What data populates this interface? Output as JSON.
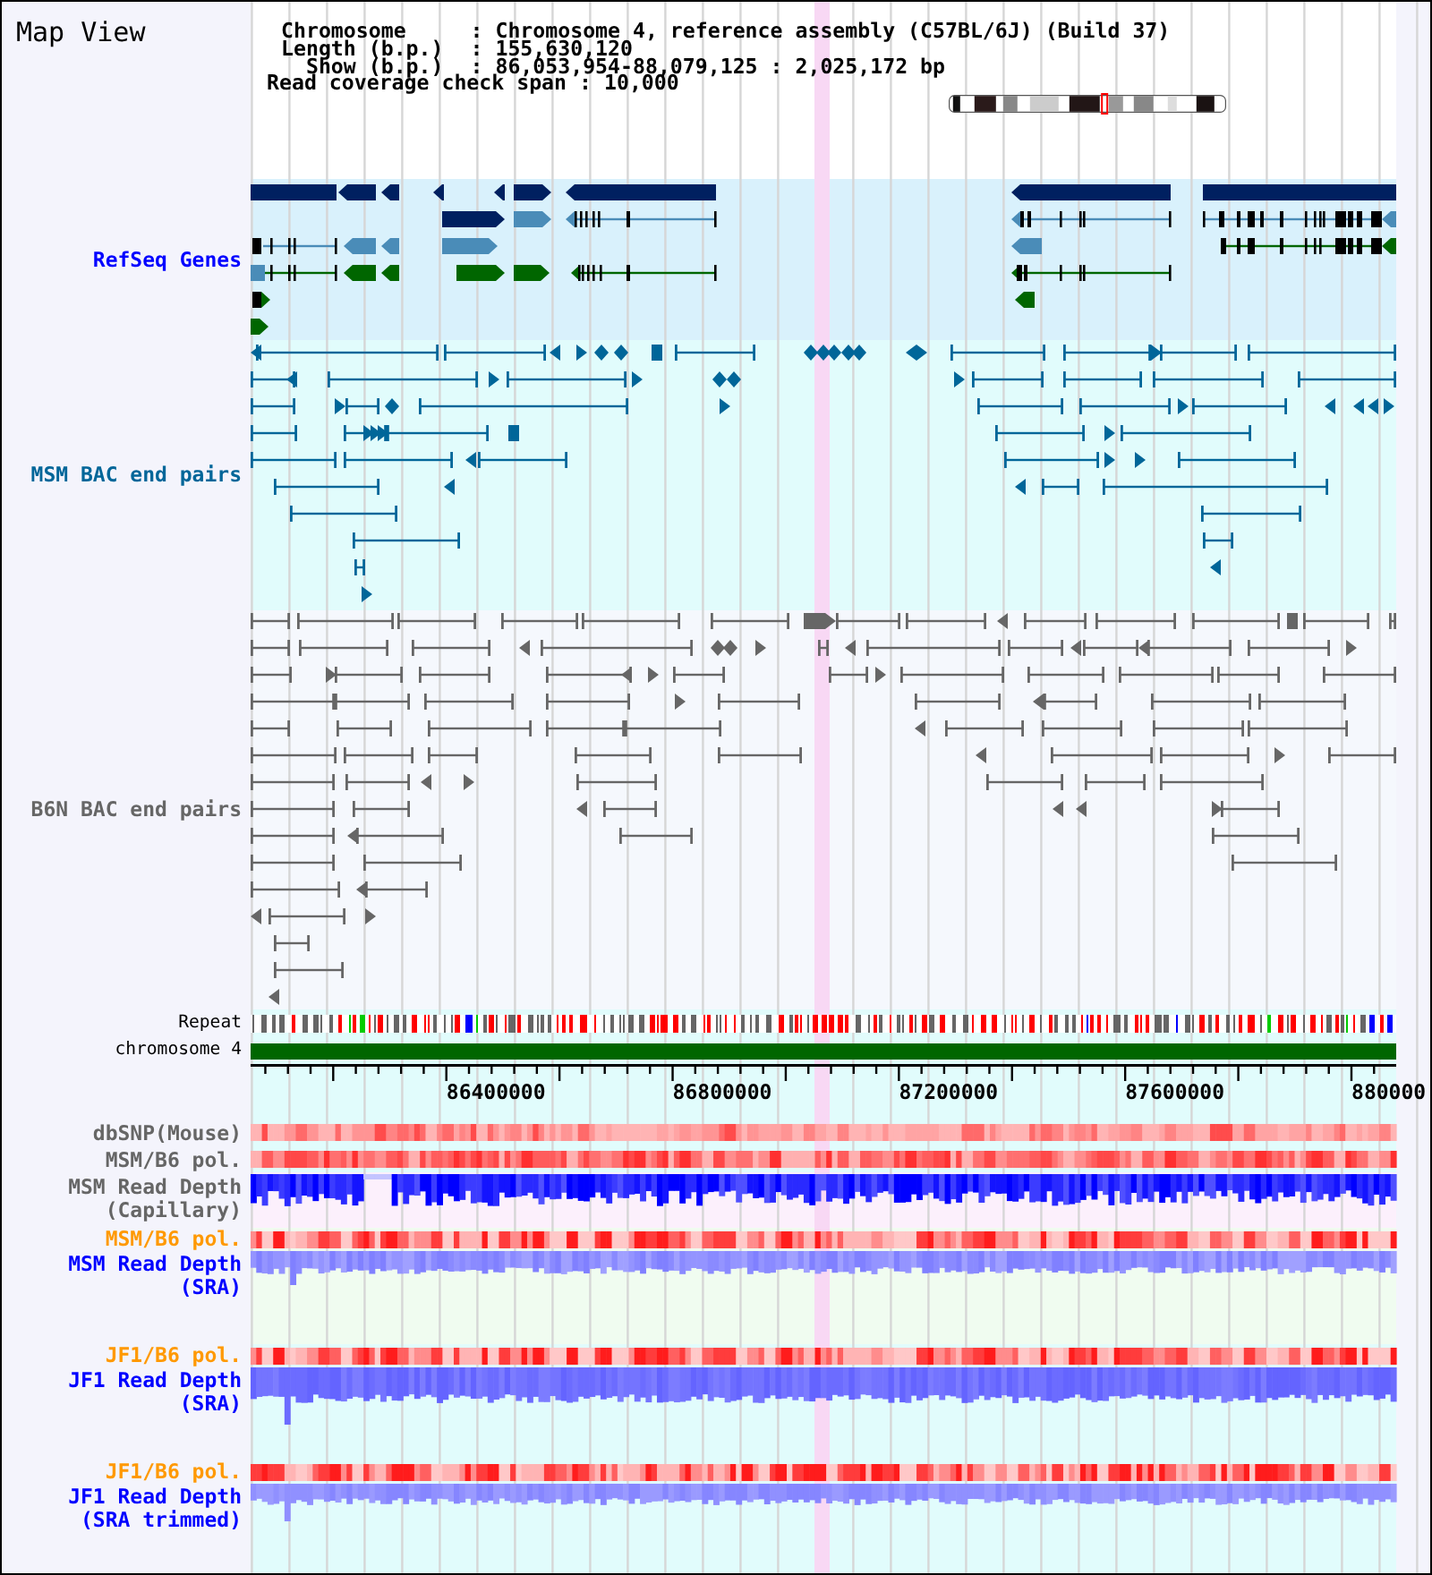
{
  "sidebar": {
    "title": "Map View"
  },
  "header": {
    "rows": [
      {
        "label": "Chromosome",
        "value": ": Chromosome 4, reference assembly (C57BL/6J) (Build 37)"
      },
      {
        "label": "Length (b.p.)",
        "value": ": 155,630,120"
      },
      {
        "label": "Show (b.p.)",
        "value": ": 86,053,954-88,079,125 : 2,025,172 bp"
      }
    ],
    "span": {
      "label": "Read coverage check span",
      "value": ": 10,000"
    }
  },
  "tracks": [
    {
      "kind": "genes",
      "label": "RefSeq Genes",
      "color": "#0000ff"
    },
    {
      "kind": "pairs",
      "label": "MSM BAC end pairs",
      "color": "#006699"
    },
    {
      "kind": "pairs",
      "label": "B6N BAC end pairs",
      "color": "#666666"
    },
    {
      "kind": "repeat",
      "label": "Repeat",
      "color": "#000000"
    },
    {
      "kind": "chromosome",
      "label": "chromosome 4",
      "color": "#000000"
    },
    {
      "kind": "ruler",
      "ticks": [
        "86400000",
        "86800000",
        "87200000",
        "87600000",
        "880000"
      ]
    },
    {
      "kind": "heat",
      "label": "dbSNP(Mouse)",
      "color": "#666666"
    },
    {
      "kind": "heat",
      "label": "MSM/B6 pol.",
      "color": "#666666"
    },
    {
      "kind": "depth",
      "label": "MSM Read Depth (Capillary)",
      "color": "#666666"
    },
    {
      "kind": "heat",
      "label": "MSM/B6 pol.",
      "color": "#ff9900"
    },
    {
      "kind": "depth",
      "label": "MSM Read Depth (SRA)",
      "color": "#0000ff"
    },
    {
      "kind": "heat",
      "label": "JF1/B6 pol.",
      "color": "#ff9900"
    },
    {
      "kind": "depth",
      "label": "JF1 Read Depth (SRA)",
      "color": "#0000ff"
    },
    {
      "kind": "heat",
      "label": "JF1/B6 pol.",
      "color": "#ff9900"
    },
    {
      "kind": "depth",
      "label": "JF1 Read Depth (SRA trimmed)",
      "color": "#0000ff"
    }
  ]
}
